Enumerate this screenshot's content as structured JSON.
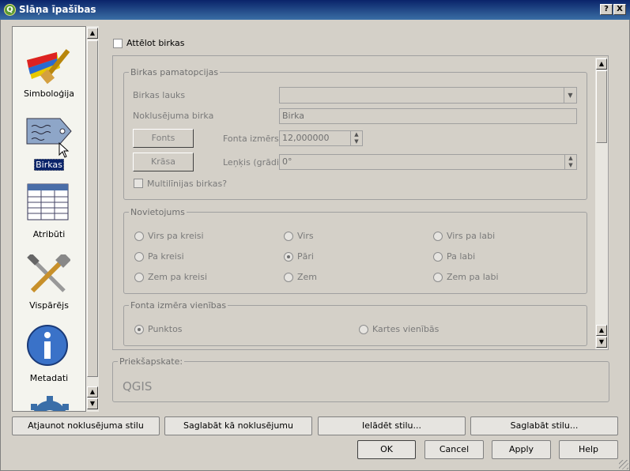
{
  "title": "Slāņa īpašības",
  "title_buttons": {
    "help": "?",
    "close": "X"
  },
  "sidebar": {
    "items": [
      {
        "label": "Simboloģija",
        "icon": "brush-icon"
      },
      {
        "label": "Birkas",
        "icon": "label-tag-icon",
        "selected": true
      },
      {
        "label": "Atribūti",
        "icon": "table-icon"
      },
      {
        "label": "Vispārējs",
        "icon": "tools-icon"
      },
      {
        "label": "Metadati",
        "icon": "info-icon"
      }
    ]
  },
  "show_labels": "Attēlot birkas",
  "basic": {
    "title": "Birkas pamatopcijas",
    "field_label": "Birkas lauks",
    "field_value": "",
    "default_label": "Noklusējuma birka",
    "default_value": "Birka",
    "font_button": "Fonts",
    "font_size_label": "Fonta izmērs",
    "font_size_value": "12,000000",
    "color_button": "Krāsa",
    "angle_label": "Leņķis (grādi)",
    "angle_value": "0°",
    "multiline": "Multilīnijas birkas?"
  },
  "placement": {
    "title": "Novietojums",
    "options": [
      "Virs pa kreisi",
      "Virs",
      "Virs pa labi",
      "Pa kreisi",
      "Pāri",
      "Pa labi",
      "Zem pa kreisi",
      "Zem",
      "Zem pa labi"
    ],
    "selected": "Pāri"
  },
  "font_units": {
    "title": "Fonta izmēra vienības",
    "points": "Punktos",
    "map_units": "Kartes vienībās",
    "selected": "Punktos"
  },
  "preview": {
    "title": "Priekšapskate:",
    "text": "QGIS"
  },
  "style_buttons": {
    "restore": "Atjaunot noklusējuma stilu",
    "save_default": "Saglabāt kā noklusējumu",
    "load": "Ielādēt stilu...",
    "save": "Saglabāt stilu..."
  },
  "dialog_buttons": {
    "ok": "OK",
    "cancel": "Cancel",
    "apply": "Apply",
    "help": "Help"
  }
}
